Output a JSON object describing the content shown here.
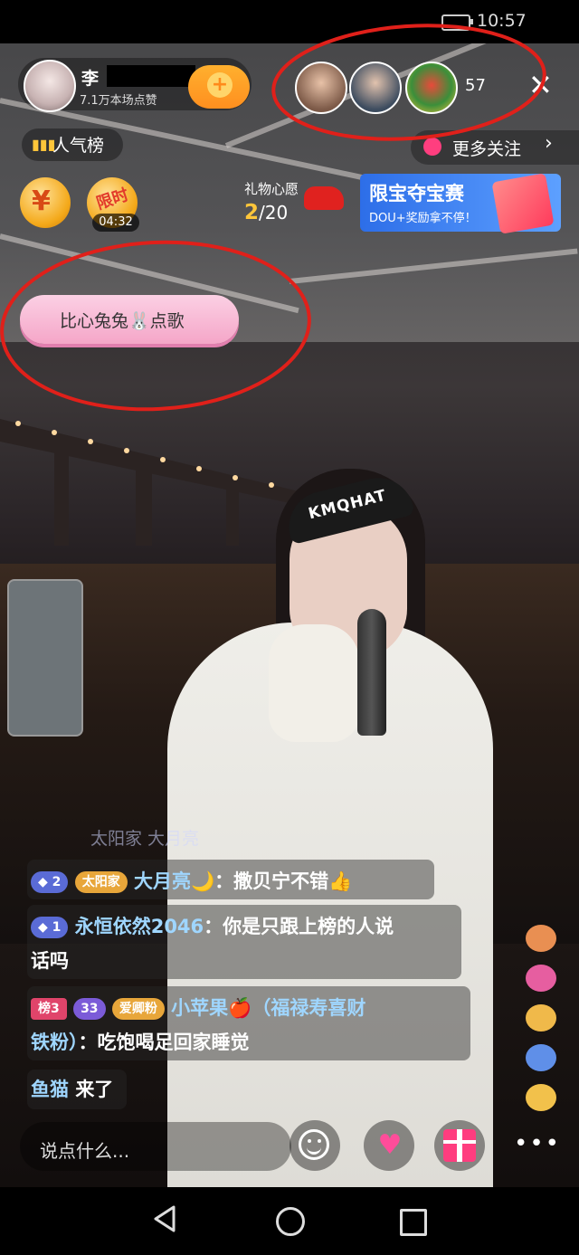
{
  "status_bar": {
    "time": "10:57"
  },
  "host": {
    "name": "李",
    "likes": "7.1万本场点赞"
  },
  "viewers": {
    "count": "57"
  },
  "rank_label": "人气榜",
  "more_follow_label": "更多关注",
  "timer": "04:32",
  "limit_label": "限时",
  "coin_symbol": "¥",
  "wish": {
    "label": "礼物心愿",
    "current": "2",
    "total": "/20"
  },
  "banner": {
    "title": "限宝夺宝赛",
    "subtitle": "DOU+奖励拿不停！"
  },
  "song_bubble": {
    "text": "比心兔兔🐰点歌"
  },
  "comments": {
    "faded": "太阳家  大月亮",
    "c1": {
      "dia_level": "2",
      "fan_badge": "太阳家",
      "user": "大月亮🌙",
      "sep": "：",
      "text": "撒贝宁不错👍"
    },
    "c2": {
      "dia_level": "1",
      "user": "永恒依然2046",
      "sep": "：",
      "text_line1": "你是只跟上榜的人说",
      "text_line2": "话吗"
    },
    "c3": {
      "rank_badge": "榜3",
      "level_badge": "33",
      "fan_badge": "爱卿粉",
      "user": "小苹果🍎",
      "paren": "（福禄寿喜财",
      "user_line2": "铁粉）",
      "sep": "：",
      "text": "吃饱喝足回家睡觉"
    },
    "c4": {
      "user": "鱼猫",
      "text": "来了"
    }
  },
  "input": {
    "placeholder": "说点什么..."
  },
  "overlay_text": {
    "visor": "KMQHAT"
  },
  "colors": {
    "follow": "#ff9a1f",
    "rank_icon": "#ffc63a",
    "annotation": "#e0201a",
    "banner": "#2d6ee8"
  }
}
